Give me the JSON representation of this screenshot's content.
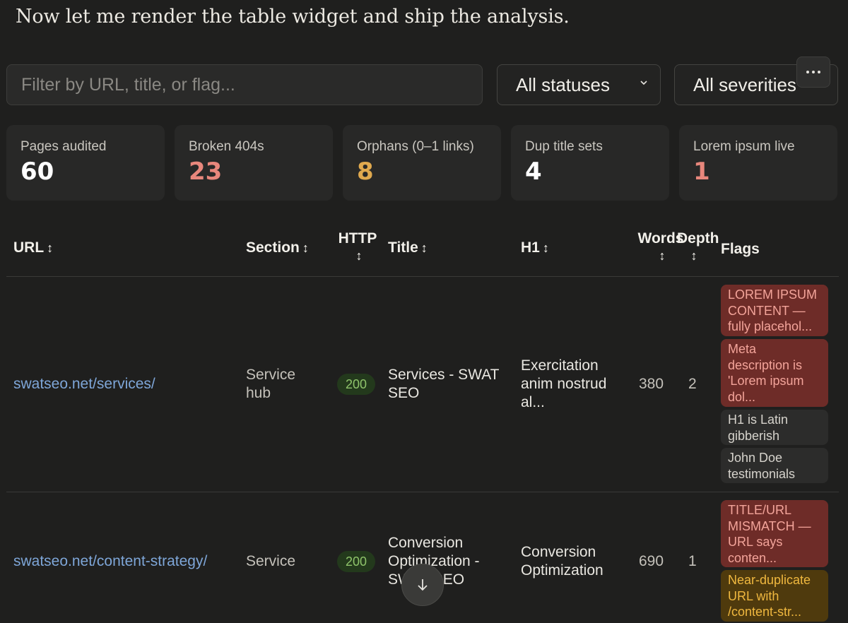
{
  "intro_text": "Now let me render the table widget and ship the analysis.",
  "filters": {
    "search_placeholder": "Filter by URL, title, or flag...",
    "status_selected": "All statuses",
    "severity_selected": "All severities"
  },
  "stats": [
    {
      "label": "Pages audited",
      "value": "60",
      "color": "#ffffff"
    },
    {
      "label": "Broken 404s",
      "value": "23",
      "color": "#e8877c"
    },
    {
      "label": "Orphans (0–1 links)",
      "value": "8",
      "color": "#e0a94e"
    },
    {
      "label": "Dup title sets",
      "value": "4",
      "color": "#ffffff"
    },
    {
      "label": "Lorem ipsum live",
      "value": "1",
      "color": "#e8877c"
    }
  ],
  "table": {
    "headers": {
      "url": "URL",
      "section": "Section",
      "http": "HTTP",
      "title": "Title",
      "h1": "H1",
      "words": "Words",
      "depth": "Depth",
      "flags": "Flags",
      "sort_icon": "↕"
    },
    "rows": [
      {
        "url": "swatseo.net/services/",
        "section": "Service hub",
        "http": "200",
        "title": "Services - SWAT SEO",
        "h1": "Exercitation anim nostrud al...",
        "words": "380",
        "depth": "2",
        "flags": [
          {
            "text": "LOREM IPSUM CONTENT — fully placehol...",
            "severity": "red"
          },
          {
            "text": "Meta description is 'Lorem ipsum dol...",
            "severity": "red"
          },
          {
            "text": "H1 is Latin gibberish",
            "severity": "gray"
          },
          {
            "text": "John Doe testimonials",
            "severity": "gray"
          }
        ]
      },
      {
        "url": "swatseo.net/content-strategy/",
        "section": "Service",
        "http": "200",
        "title": "Conversion Optimization - SWAT SEO",
        "h1": "Conversion Optimization",
        "words": "690",
        "depth": "1",
        "flags": [
          {
            "text": "TITLE/URL MISMATCH — URL says conten...",
            "severity": "red"
          },
          {
            "text": "Near-duplicate URL with /content-str...",
            "severity": "amber"
          }
        ]
      }
    ]
  },
  "icons": {
    "more": "more-icon",
    "scroll": "arrow-down-icon",
    "chevron": "chevron-down-icon"
  }
}
